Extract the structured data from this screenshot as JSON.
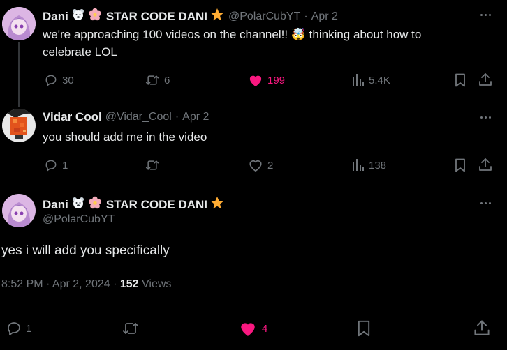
{
  "tweet1": {
    "display_name": "Dani",
    "display_name_suffix": "STAR CODE DANI",
    "handle": "@PolarCubYT",
    "separator": "·",
    "date": "Apr 2",
    "text_line1": "we're approaching 100 videos on the channel!! 🤯 thinking about how to",
    "text_line2": "celebrate LOL",
    "replies": "30",
    "reposts": "6",
    "likes": "199",
    "views": "5.4K"
  },
  "tweet2": {
    "display_name": "Vidar Cool",
    "handle": "@Vidar_Cool",
    "separator": "·",
    "date": "Apr 2",
    "text": "you should add me in the video",
    "replies": "1",
    "reposts": "",
    "likes": "2",
    "views": "138"
  },
  "main_tweet": {
    "display_name": "Dani",
    "display_name_suffix": "STAR CODE DANI",
    "handle": "@PolarCubYT",
    "text": "yes i will add you specifically",
    "timestamp": "8:52 PM · Apr 2, 2024 · ",
    "views_count": "152",
    "views_label": " Views",
    "replies": "1",
    "likes": "4"
  },
  "colors": {
    "background": "#000000",
    "text": "#e7e9ea",
    "muted": "#71767b",
    "like_pink": "#f91880",
    "avatar_pink": "#e8c6ea"
  },
  "icons": [
    "reply-icon",
    "repost-icon",
    "heart-icon",
    "views-icon",
    "bookmark-icon",
    "share-icon",
    "more-icon",
    "polar-bear-emoji",
    "cherry-blossom-emoji",
    "star-emoji"
  ]
}
